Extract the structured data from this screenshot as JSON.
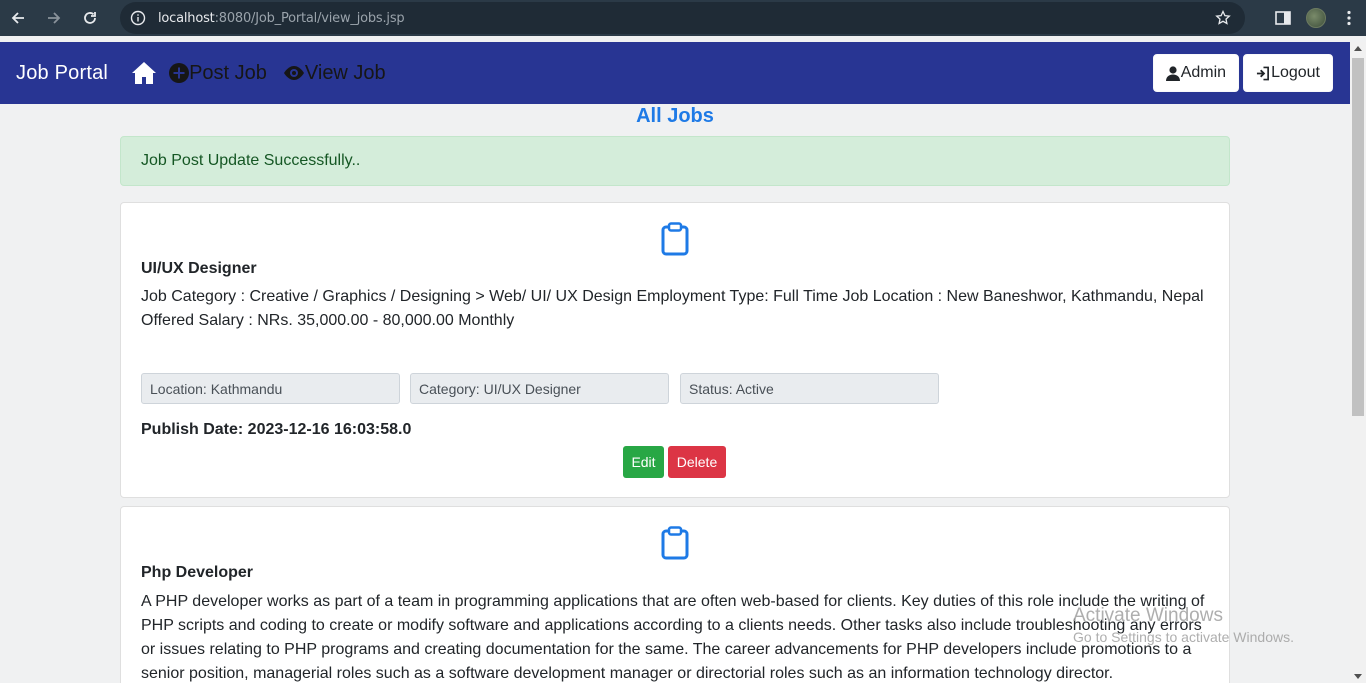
{
  "browser": {
    "url_host": "localhost",
    "url_rest": ":8080/Job_Portal/view_jobs.jsp"
  },
  "navbar": {
    "brand": "Job Portal",
    "post_job": "Post Job",
    "view_job": "View Job",
    "admin": "Admin",
    "logout": "Logout"
  },
  "page": {
    "title": "All Jobs",
    "alert": "Job Post Update Successfully.."
  },
  "jobs": [
    {
      "title": "UI/UX Designer",
      "description": "Job Category : Creative / Graphics / Designing > Web/ UI/ UX Design Employment Type: Full Time Job Location : New Baneshwor, Kathmandu, Nepal Offered Salary : NRs. 35,000.00 - 80,000.00 Monthly",
      "location": "Location: Kathmandu",
      "category": "Category: UI/UX Designer",
      "status": "Status: Active",
      "publish_date": "Publish Date: 2023-12-16 16:03:58.0",
      "edit_label": "Edit",
      "delete_label": "Delete"
    },
    {
      "title": "Php Developer",
      "description": "A PHP developer works as part of a team in programming applications that are often web-based for clients. Key duties of this role include the writing of PHP scripts and coding to create or modify software and applications according to a clients needs. Other tasks also include troubleshooting any errors or issues relating to PHP programs and creating documentation for the same. The career advancements for PHP developers include promotions to a senior position, managerial roles such as a software development manager or directorial roles such as an information technology director."
    }
  ],
  "watermark": {
    "line1": "Activate Windows",
    "line2": "Go to Settings to activate Windows."
  },
  "colors": {
    "navbar": "#283593",
    "accent": "#1e7ae6",
    "edit": "#28a745",
    "delete": "#dc3545"
  }
}
